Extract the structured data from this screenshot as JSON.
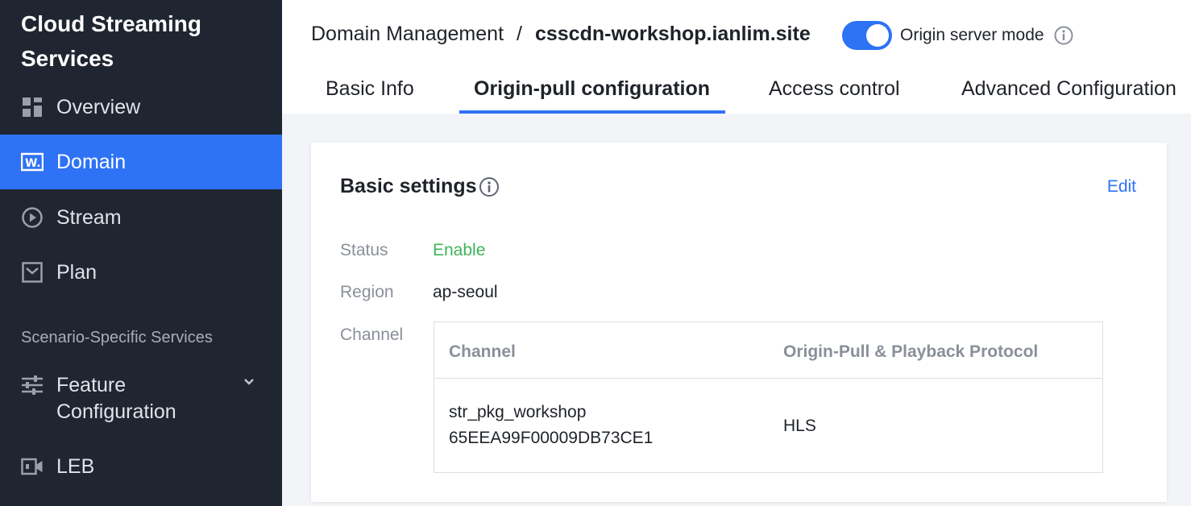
{
  "sidebar": {
    "brand_line1": "Cloud Streaming",
    "brand_line2": "Services",
    "items": [
      {
        "label": "Overview",
        "icon": "dashboard-icon"
      },
      {
        "label": "Domain",
        "icon": "domain-icon"
      },
      {
        "label": "Stream",
        "icon": "play-circle-icon"
      },
      {
        "label": "Plan",
        "icon": "package-icon"
      }
    ],
    "section_label": "Scenario-Specific Services",
    "feature_line1": "Feature",
    "feature_line2": "Configuration",
    "leb_label": "LEB"
  },
  "header": {
    "breadcrumb_parent": "Domain Management",
    "breadcrumb_separator": "/",
    "breadcrumb_current": "csscdn-workshop.ianlim.site",
    "origin_mode_label": "Origin server mode",
    "origin_mode_on": true
  },
  "tabs": [
    {
      "label": "Basic Info"
    },
    {
      "label": "Origin-pull configuration"
    },
    {
      "label": "Access control"
    },
    {
      "label": "Advanced Configuration"
    }
  ],
  "card": {
    "title": "Basic settings",
    "edit_label": "Edit",
    "status_label": "Status",
    "status_value": "Enable",
    "region_label": "Region",
    "region_value": "ap-seoul",
    "channel_label": "Channel",
    "table": {
      "headers": [
        "Channel",
        "Origin-Pull & Playback Protocol"
      ],
      "rows": [
        {
          "channel_name": "str_pkg_workshop",
          "channel_id": "65EEA99F00009DB73CE1",
          "protocol": "HLS"
        }
      ]
    }
  },
  "colors": {
    "accent": "#2e72f5",
    "sidebar_bg": "#1f2531",
    "status_green": "#3eb45a"
  }
}
